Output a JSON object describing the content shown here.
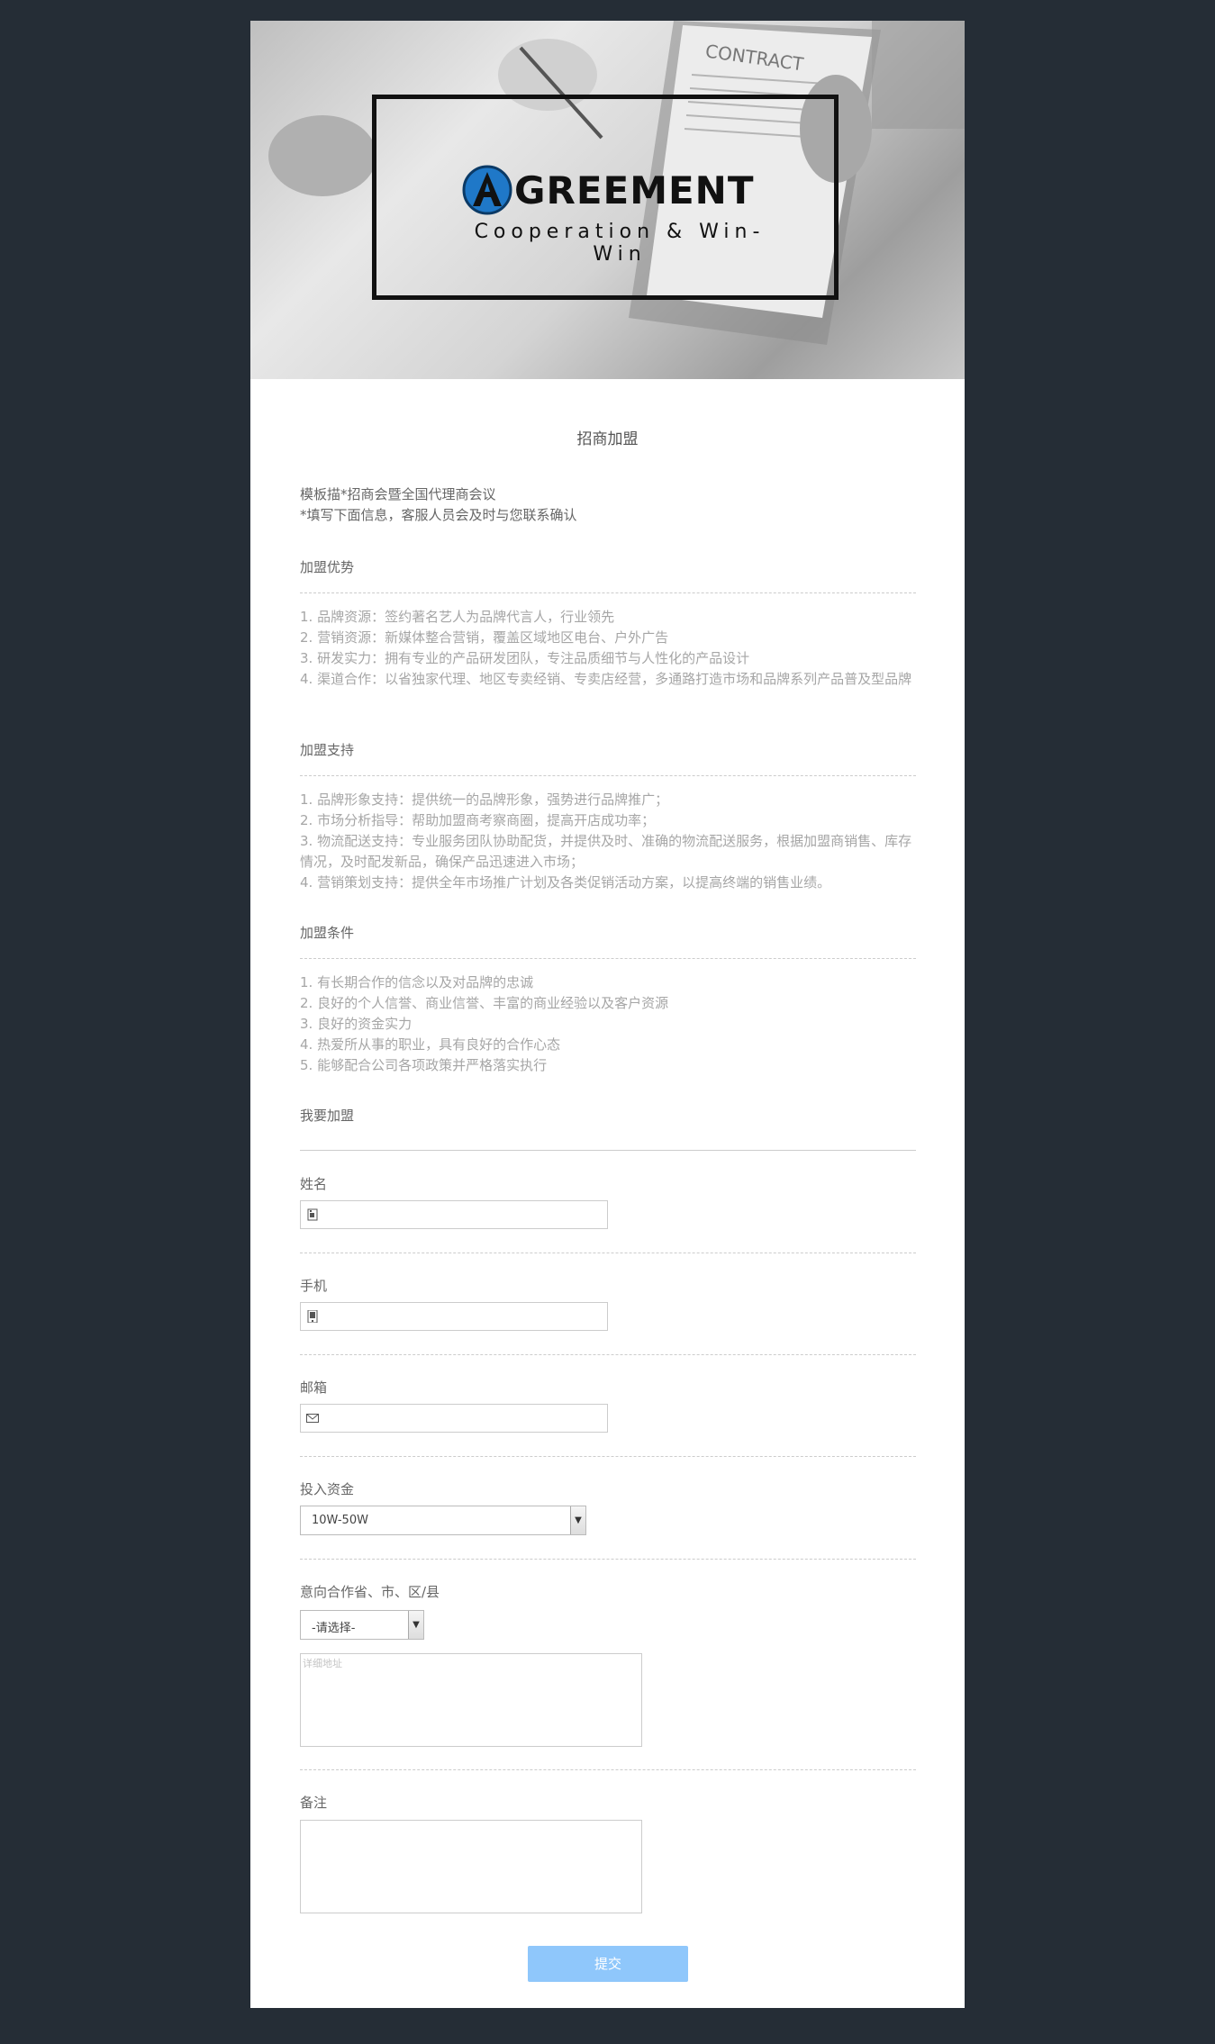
{
  "banner": {
    "contract_text": "CONTRACT",
    "logo_word": "GREEMENT",
    "tagline": "Cooperation & Win-Win"
  },
  "form_title": "招商加盟",
  "intro": {
    "line1": "模板描*招商会暨全国代理商会议",
    "line2": "*填写下面信息，客服人员会及时与您联系确认"
  },
  "sections": [
    {
      "title": "加盟优势",
      "items": [
        "1. 品牌资源：签约著名艺人为品牌代言人，行业领先",
        "2. 营销资源：新媒体整合营销，覆盖区域地区电台、户外广告",
        "3. 研发实力：拥有专业的产品研发团队，专注品质细节与人性化的产品设计",
        "4. 渠道合作：以省独家代理、地区专卖经销、专卖店经营，多通路打造市场和品牌系列产品普及型品牌"
      ]
    },
    {
      "title": "加盟支持",
      "items": [
        "1. 品牌形象支持：提供统一的品牌形象，强势进行品牌推广；",
        "2. 市场分析指导：帮助加盟商考察商圈，提高开店成功率；",
        "3. 物流配送支持：专业服务团队协助配货，并提供及时、准确的物流配送服务，根据加盟商销售、库存情况，及时配发新品，确保产品迅速进入市场；",
        "4. 营销策划支持：提供全年市场推广计划及各类促销活动方案，以提高终端的销售业绩。"
      ]
    },
    {
      "title": "加盟条件",
      "items": [
        "1. 有长期合作的信念以及对品牌的忠诚",
        "2. 良好的个人信誉、商业信誉、丰富的商业经验以及客户资源",
        "3. 良好的资金实力",
        "4. 热爱所从事的职业，具有良好的合作心态",
        "5. 能够配合公司各项政策并严格落实执行"
      ]
    }
  ],
  "join_heading": "我要加盟",
  "fields": {
    "name_label": "姓名",
    "phone_label": "手机",
    "email_label": "邮箱",
    "capital_label": "投入资金",
    "capital_value": "10W-50W",
    "region_label": "意向合作省、市、区/县",
    "region_value": "-请选择-",
    "address_placeholder": "详细地址",
    "remark_label": "备注"
  },
  "submit_label": "提交"
}
